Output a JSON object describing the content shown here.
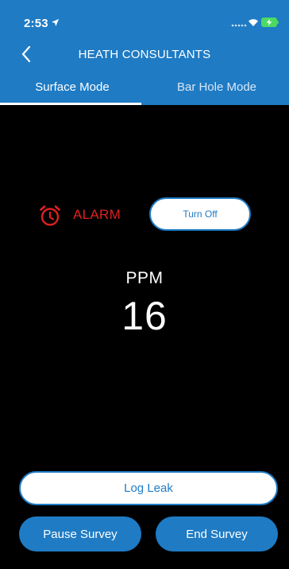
{
  "status_bar": {
    "time": "2:53",
    "location_icon": "location-arrow-icon",
    "signal_icon": "signal-dots-icon",
    "wifi_icon": "wifi-icon",
    "battery_icon": "battery-charging-icon"
  },
  "nav": {
    "back_icon": "chevron-left-icon",
    "title": "HEATH CONSULTANTS"
  },
  "tabs": [
    {
      "label": "Surface Mode",
      "active": true
    },
    {
      "label": "Bar Hole Mode",
      "active": false
    }
  ],
  "alarm": {
    "icon": "alarm-clock-icon",
    "label": "ALARM",
    "turn_off_label": "Turn Off"
  },
  "reading": {
    "unit_label": "PPM",
    "value": "16"
  },
  "actions": {
    "log_leak_label": "Log Leak",
    "pause_label": "Pause Survey",
    "end_label": "End Survey"
  },
  "colors": {
    "brand_blue": "#1f7bc4",
    "alarm_red": "#e02020",
    "background": "#000000",
    "battery_green": "#4cd964"
  }
}
